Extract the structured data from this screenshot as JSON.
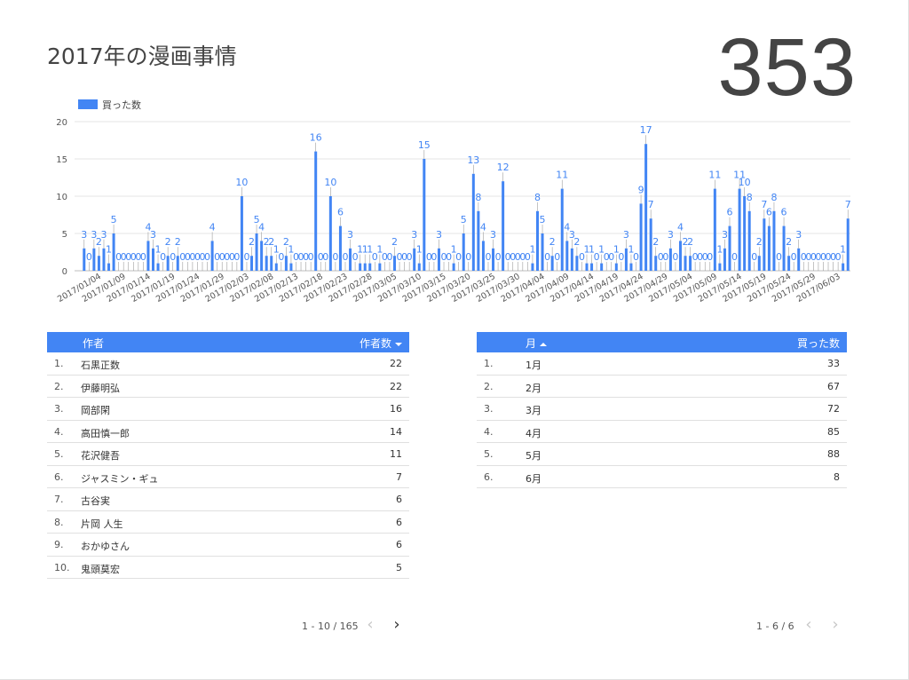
{
  "header": {
    "title": "2017年の漫画事情",
    "total": "353"
  },
  "chart_data": {
    "type": "bar",
    "legend": [
      "買った数"
    ],
    "legend_position": "top-left",
    "ylim": [
      0,
      20
    ],
    "yticks": [
      "0",
      "5",
      "10",
      "15",
      "20"
    ],
    "grid": true,
    "color": "#4285f4",
    "start_date": "2017-01-01",
    "xtick_labels": [
      "2017/01/04",
      "2017/01/09",
      "2017/01/14",
      "2017/01/19",
      "2017/01/24",
      "2017/01/29",
      "2017/02/03",
      "2017/02/08",
      "2017/02/13",
      "2017/02/18",
      "2017/02/23",
      "2017/02/28",
      "2017/03/05",
      "2017/03/10",
      "2017/03/15",
      "2017/03/20",
      "2017/03/25",
      "2017/03/30",
      "2017/04/04",
      "2017/04/09",
      "2017/04/14",
      "2017/04/19",
      "2017/04/24",
      "2017/04/29",
      "2017/05/04",
      "2017/05/09",
      "2017/05/14",
      "2017/05/19",
      "2017/05/24",
      "2017/05/29",
      "2017/06/03"
    ],
    "series": [
      {
        "name": "買った数",
        "values": [
          3,
          0,
          3,
          2,
          3,
          1,
          5,
          0,
          0,
          0,
          0,
          0,
          0,
          4,
          3,
          1,
          0,
          2,
          0,
          2,
          0,
          0,
          0,
          0,
          0,
          0,
          4,
          0,
          0,
          0,
          0,
          0,
          10,
          0,
          2,
          5,
          4,
          2,
          2,
          1,
          0,
          2,
          1,
          0,
          0,
          0,
          0,
          16,
          0,
          0,
          10,
          0,
          6,
          0,
          3,
          0,
          1,
          1,
          1,
          0,
          1,
          0,
          0,
          2,
          0,
          0,
          0,
          3,
          1,
          15,
          0,
          0,
          3,
          0,
          0,
          1,
          0,
          5,
          0,
          13,
          8,
          4,
          0,
          3,
          0,
          12,
          0,
          0,
          0,
          0,
          0,
          1,
          8,
          5,
          0,
          2,
          0,
          11,
          4,
          3,
          2,
          0,
          1,
          1,
          0,
          1,
          0,
          0,
          1,
          0,
          3,
          1,
          0,
          9,
          17,
          7,
          2,
          0,
          0,
          3,
          0,
          4,
          2,
          2,
          0,
          0,
          0,
          0,
          11,
          1,
          3,
          6,
          0,
          11,
          10,
          8,
          0,
          2,
          7,
          6,
          8,
          0,
          6,
          2,
          0,
          3,
          0,
          0,
          0,
          0,
          0,
          0,
          0,
          0,
          1,
          7
        ]
      }
    ]
  },
  "authors_table": {
    "header_name": "作者",
    "header_value": "作者数",
    "rows": [
      {
        "rank": "1.",
        "name": "石黒正数",
        "value": "22"
      },
      {
        "rank": "2.",
        "name": "伊藤明弘",
        "value": "22"
      },
      {
        "rank": "3.",
        "name": "岡部閑",
        "value": "16"
      },
      {
        "rank": "4.",
        "name": "高田慎一郎",
        "value": "14"
      },
      {
        "rank": "5.",
        "name": "花沢健吾",
        "value": "11"
      },
      {
        "rank": "6.",
        "name": "ジャスミン・ギュ",
        "value": "7"
      },
      {
        "rank": "7.",
        "name": "古谷実",
        "value": "6"
      },
      {
        "rank": "8.",
        "name": "片岡 人生",
        "value": "6"
      },
      {
        "rank": "9.",
        "name": "おかゆさん",
        "value": "6"
      },
      {
        "rank": "10.",
        "name": "鬼頭莫宏",
        "value": "5"
      }
    ],
    "pagination": "1 - 10 / 165"
  },
  "months_table": {
    "header_name": "月",
    "header_value": "買った数",
    "rows": [
      {
        "rank": "1.",
        "name": "1月",
        "value": "33"
      },
      {
        "rank": "2.",
        "name": "2月",
        "value": "67"
      },
      {
        "rank": "3.",
        "name": "3月",
        "value": "72"
      },
      {
        "rank": "4.",
        "name": "4月",
        "value": "85"
      },
      {
        "rank": "5.",
        "name": "5月",
        "value": "88"
      },
      {
        "rank": "6.",
        "name": "6月",
        "value": "8"
      }
    ],
    "pagination": "1 - 6 / 6"
  }
}
